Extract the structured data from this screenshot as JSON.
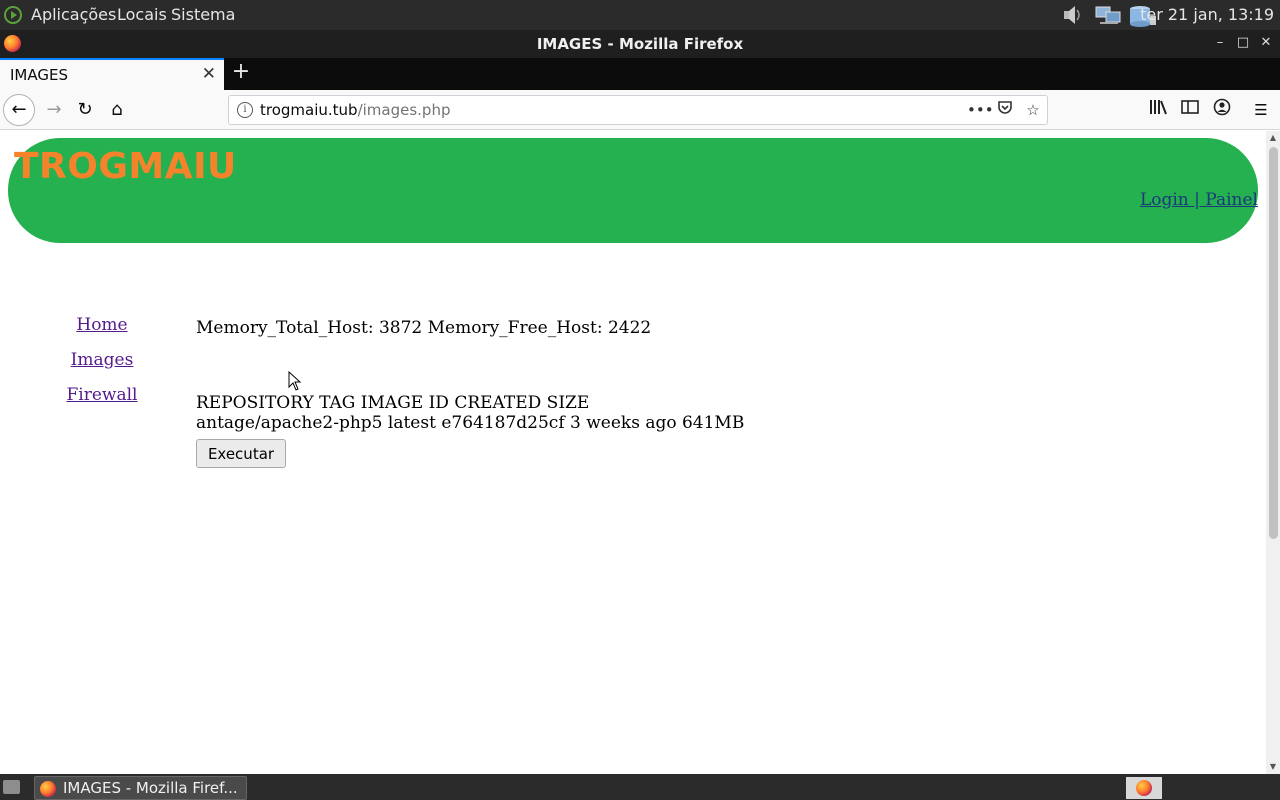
{
  "system_panel": {
    "menus": [
      "Aplicações",
      "Locais",
      "Sistema"
    ],
    "clock": "ter 21 jan, 13:19",
    "tray_icons": [
      "volume-icon",
      "network-icon",
      "storage-icon"
    ]
  },
  "window": {
    "title": "IMAGES - Mozilla Firefox",
    "minimize_glyph": "–",
    "maximize_glyph": "□",
    "close_glyph": "✕"
  },
  "tabs": [
    {
      "label": "IMAGES",
      "active": true
    }
  ],
  "browser": {
    "url_host": "trogmaiu.tub",
    "url_path": "/images.php"
  },
  "page": {
    "brand": "TROGMAIU",
    "login_link": "Login | Painel",
    "nav": [
      "Home",
      "Images",
      "Firewall"
    ],
    "memory_line": "Memory_Total_Host: 3872 Memory_Free_Host: 2422",
    "images_header": "REPOSITORY TAG IMAGE ID CREATED SIZE",
    "images_row": "antage/apache2-php5 latest e764187d25cf 3 weeks ago 641MB",
    "button_label": "Executar"
  },
  "taskbar": {
    "task_label": "IMAGES - Mozilla Firef..."
  },
  "colors": {
    "banner_green": "#25b14f",
    "brand_orange": "#f4832b",
    "link_visited": "#551a8b",
    "accent_blue": "#0a84ff"
  }
}
